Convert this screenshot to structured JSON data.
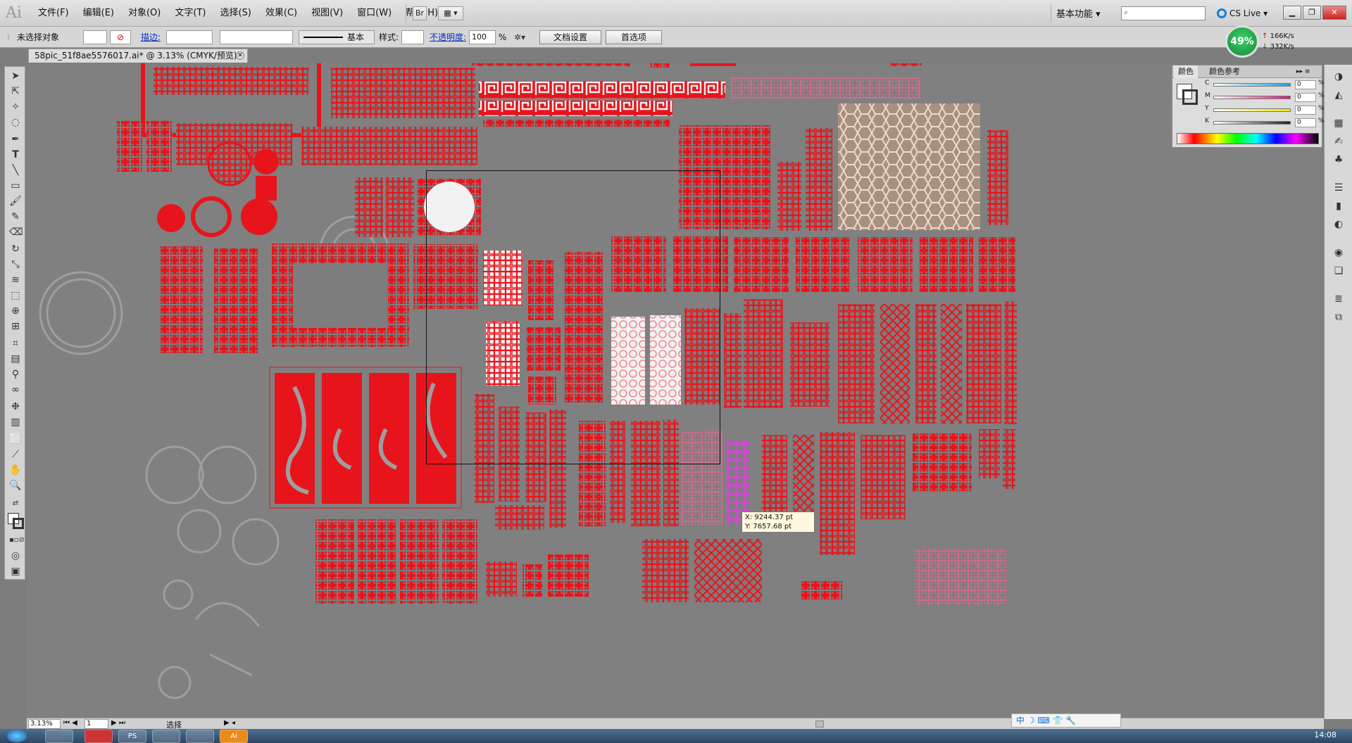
{
  "app": {
    "logo": "Ai"
  },
  "menu": {
    "items": [
      "文件(F)",
      "编辑(E)",
      "对象(O)",
      "文字(T)",
      "选择(S)",
      "效果(C)",
      "视图(V)",
      "窗口(W)",
      "帮助(H)"
    ],
    "bridge": "Br",
    "workspace": "基本功能",
    "cslive": "CS Live"
  },
  "control": {
    "selection": "未选择对象",
    "stroke_label": "描边:",
    "stroke_style": "基本",
    "style_label": "样式:",
    "opacity_label": "不透明度:",
    "opacity_value": "100",
    "opacity_unit": "%",
    "doc_settings": "文档设置",
    "preferences": "首选项"
  },
  "perf": {
    "percent": "49%",
    "up": "166K/s",
    "down": "332K/s"
  },
  "document": {
    "tab_title": "58pic_51f8ae5576017.ai* @ 3.13% (CMYK/预览)"
  },
  "tooltip": {
    "x": "X: 9244.37 pt",
    "y": "Y: 7657.68 pt"
  },
  "color_panel": {
    "tab_color": "颜色",
    "tab_guide": "颜色参考",
    "channels": [
      {
        "label": "C",
        "value": "0",
        "unit": "%",
        "color": "#16a5e8"
      },
      {
        "label": "M",
        "value": "0",
        "unit": "%",
        "color": "#e0157a"
      },
      {
        "label": "Y",
        "value": "0",
        "unit": "%",
        "color": "#f2e600"
      },
      {
        "label": "K",
        "value": "0",
        "unit": "%",
        "color": "#222222"
      }
    ]
  },
  "status": {
    "zoom": "3.13%",
    "page": "1",
    "tool": "选择"
  },
  "ime": {
    "label": "中"
  },
  "taskbar": {
    "clock": "14:08",
    "apps": [
      "PS",
      "",
      "",
      "Ai"
    ]
  },
  "colors": {
    "pattern_red": "#e8141c",
    "artboard": "#f2f2f2",
    "canvas": "#808080"
  }
}
